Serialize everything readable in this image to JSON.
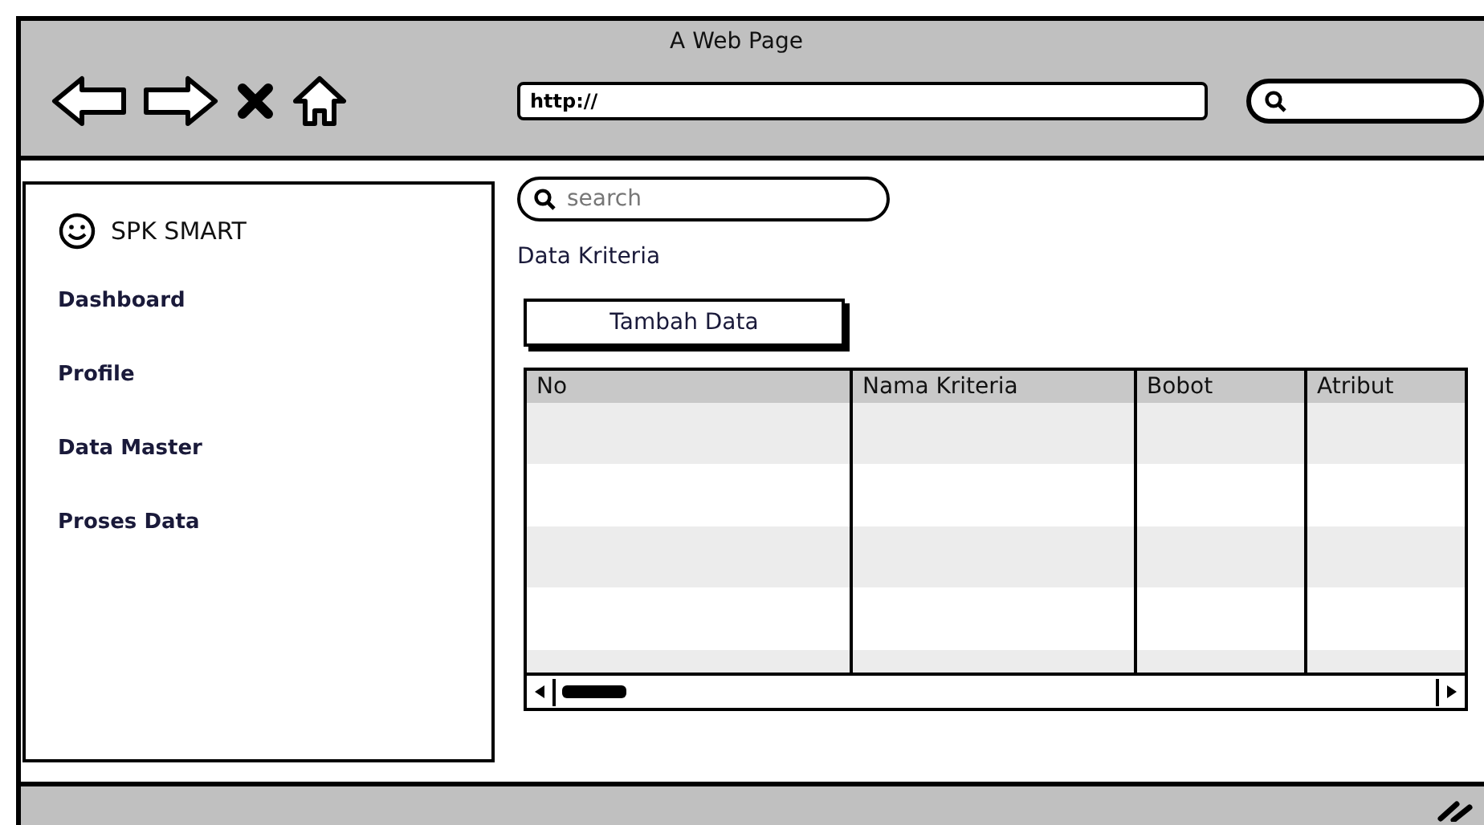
{
  "window": {
    "title": "A Web Page",
    "address": "http://"
  },
  "sidebar": {
    "brand": "SPK SMART",
    "items": [
      {
        "label": "Dashboard"
      },
      {
        "label": "Profile"
      },
      {
        "label": "Data Master"
      },
      {
        "label": "Proses Data"
      }
    ]
  },
  "search": {
    "placeholder": "search"
  },
  "heading": "Data Kriteria",
  "add_button": "Tambah Data",
  "table": {
    "columns": [
      "No",
      "Nama Kriteria",
      "Bobot",
      "Atribut"
    ]
  }
}
